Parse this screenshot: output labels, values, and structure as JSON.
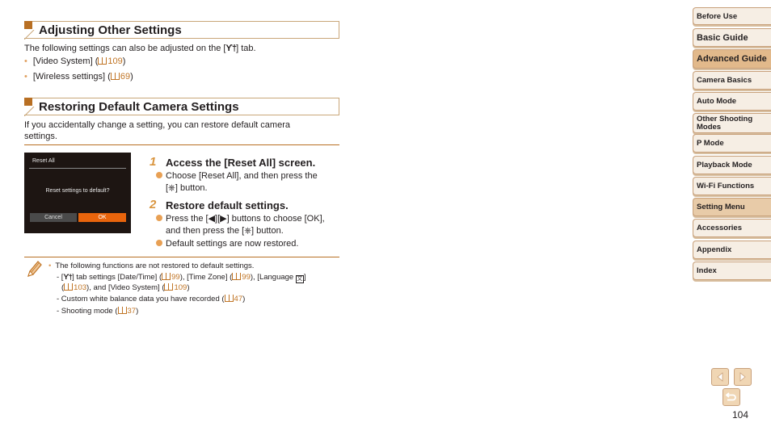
{
  "section1": {
    "title": "Adjusting Other Settings",
    "intro_pre": "The following settings can also be adjusted on the [",
    "intro_icon": "wrench-tab-icon",
    "intro_post": "] tab.",
    "bullets": [
      {
        "label": "[Video System] (",
        "page": "109",
        "close": ")"
      },
      {
        "label": "[Wireless settings] (",
        "page": "69",
        "close": ")"
      }
    ]
  },
  "section2": {
    "title": "Restoring Default Camera Settings",
    "intro_line1": "If you accidentally change a setting, you can restore default camera",
    "intro_line2": "settings."
  },
  "camera_screen": {
    "title": "Reset All",
    "question": "Reset settings to default?",
    "cancel_label": "Cancel",
    "ok_label": "OK",
    "ok_color": "#e8640c"
  },
  "steps": [
    {
      "number": "1",
      "title": "Access the [Reset All] screen.",
      "items": [
        {
          "line1": "Choose [Reset All], and then press the",
          "line2": "[⎈] button."
        }
      ]
    },
    {
      "number": "2",
      "title": "Restore default settings.",
      "items": [
        {
          "line1": "Press the [◀][▶] buttons to choose [OK],",
          "line2": "and then press the [⎈] button."
        },
        {
          "line1": "Default settings are now restored.",
          "line2": ""
        }
      ]
    }
  ],
  "note": {
    "icon": "pencil-icon",
    "main": "The following functions are not restored to default settings.",
    "sub": [
      {
        "parts": [
          "- [",
          "] tab settings [Date/Time] (",
          "99",
          "), [Time Zone] (",
          "99",
          "), [Language "
        ],
        "line2": [
          "(",
          "103",
          "), and [Video System] (",
          "109",
          ")"
        ]
      },
      {
        "text": "- Custom white balance data you have recorded (",
        "page": "47",
        "close": ")"
      },
      {
        "text": "- Shooting mode (",
        "page": "37",
        "close": ")"
      }
    ]
  },
  "sidebar": {
    "items": [
      {
        "label": "Before Use",
        "state": "normal"
      },
      {
        "label": "Basic Guide",
        "state": "big"
      },
      {
        "label": "Advanced Guide",
        "state": "active"
      },
      {
        "label": "Camera Basics",
        "state": "normal"
      },
      {
        "label": "Auto Mode",
        "state": "normal"
      },
      {
        "label": "Other Shooting Modes",
        "state": "normal"
      },
      {
        "label": "P Mode",
        "state": "normal"
      },
      {
        "label": "Playback Mode",
        "state": "normal"
      },
      {
        "label": "Wi-Fi Functions",
        "state": "normal"
      },
      {
        "label": "Setting Menu",
        "state": "highlight"
      },
      {
        "label": "Accessories",
        "state": "normal"
      },
      {
        "label": "Appendix",
        "state": "normal"
      },
      {
        "label": "Index",
        "state": "normal"
      }
    ]
  },
  "nav": {
    "prev": "prev-page-icon",
    "next": "next-page-icon",
    "back": "return-icon"
  },
  "page_number": "104",
  "colors": {
    "accent": "#b86f23",
    "link": "#c07424",
    "sidebar_active": "#e2b98b"
  }
}
